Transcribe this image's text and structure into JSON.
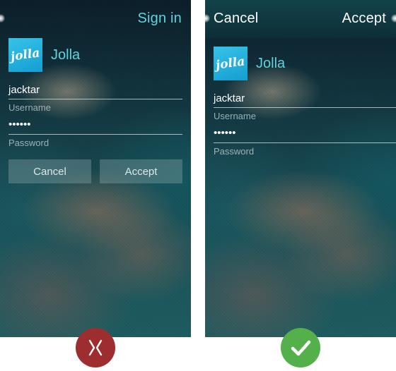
{
  "left_screen": {
    "topbar_label": "Sign in",
    "account_name": "Jolla",
    "logo_text": "jolla",
    "username": {
      "value": "jacktar",
      "caption": "Username"
    },
    "password": {
      "value": "••••••",
      "caption": "Password"
    },
    "cancel_button": "Cancel",
    "accept_button": "Accept"
  },
  "right_screen": {
    "cancel_label": "Cancel",
    "accept_label": "Accept",
    "account_name": "Jolla",
    "logo_text": "jolla",
    "username": {
      "value": "jacktar",
      "caption": "Username"
    },
    "password": {
      "value": "••••••",
      "caption": "Password"
    }
  },
  "verdicts": {
    "left": {
      "icon": "cross-icon",
      "color": "#9e2d2f"
    },
    "right": {
      "icon": "checkmark-icon",
      "color": "#53b04a"
    }
  },
  "colors": {
    "accent": "#5fd3de",
    "logo_blue": "#1ea9dc"
  }
}
